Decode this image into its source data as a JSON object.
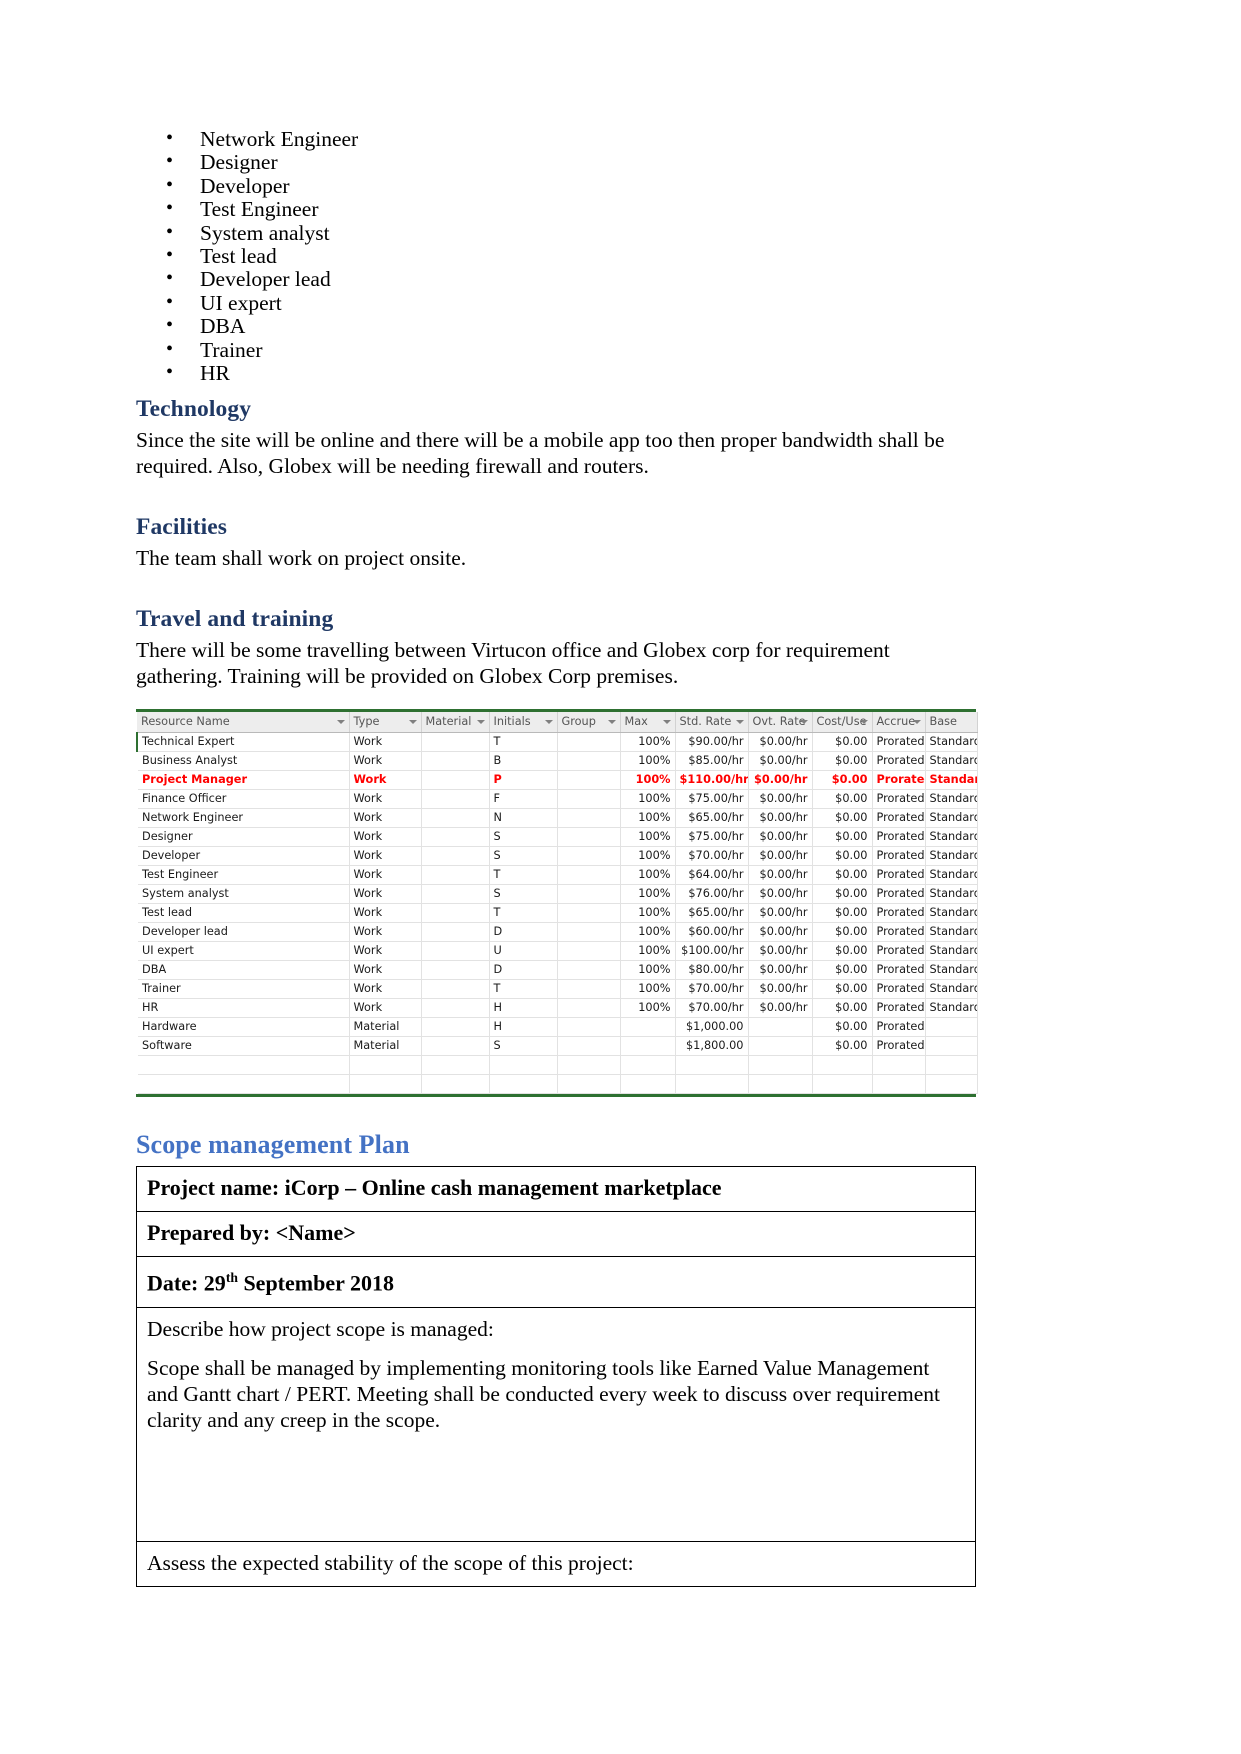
{
  "roles_list": [
    "Network Engineer",
    "Designer",
    "Developer",
    "Test Engineer",
    "System analyst",
    "Test lead",
    "Developer lead",
    "UI expert",
    "DBA",
    "Trainer",
    "HR"
  ],
  "sections": [
    {
      "heading": "Technology",
      "body": "Since the site will be online and there will be a mobile app too then proper bandwidth shall be required. Also, Globex will be needing firewall and routers."
    },
    {
      "heading": "Facilities",
      "body": "The team shall work on project onsite."
    },
    {
      "heading": "Travel and training",
      "body": "There will be some travelling between Virtucon office and Globex corp for requirement gathering. Training will be provided on Globex Corp premises."
    }
  ],
  "resource_table": {
    "columns": [
      "Resource Name",
      "Type",
      "Material",
      "Initials",
      "Group",
      "Max",
      "Std. Rate",
      "Ovt. Rate",
      "Cost/Use",
      "Accrue",
      "Base"
    ],
    "rows": [
      {
        "name": "Technical Expert",
        "type": "Work",
        "material": "",
        "initials": "T",
        "group": "",
        "max": "100%",
        "std_rate": "$90.00/hr",
        "ovt_rate": "$0.00/hr",
        "cost_use": "$0.00",
        "accrue": "Prorated",
        "base": "Standard",
        "highlight": false
      },
      {
        "name": "Business Analyst",
        "type": "Work",
        "material": "",
        "initials": "B",
        "group": "",
        "max": "100%",
        "std_rate": "$85.00/hr",
        "ovt_rate": "$0.00/hr",
        "cost_use": "$0.00",
        "accrue": "Prorated",
        "base": "Standard",
        "highlight": false
      },
      {
        "name": "Project Manager",
        "type": "Work",
        "material": "",
        "initials": "P",
        "group": "",
        "max": "100%",
        "std_rate": "$110.00/hr",
        "ovt_rate": "$0.00/hr",
        "cost_use": "$0.00",
        "accrue": "Prorated",
        "base": "Standard",
        "highlight": true
      },
      {
        "name": "Finance Officer",
        "type": "Work",
        "material": "",
        "initials": "F",
        "group": "",
        "max": "100%",
        "std_rate": "$75.00/hr",
        "ovt_rate": "$0.00/hr",
        "cost_use": "$0.00",
        "accrue": "Prorated",
        "base": "Standard",
        "highlight": false
      },
      {
        "name": "Network Engineer",
        "type": "Work",
        "material": "",
        "initials": "N",
        "group": "",
        "max": "100%",
        "std_rate": "$65.00/hr",
        "ovt_rate": "$0.00/hr",
        "cost_use": "$0.00",
        "accrue": "Prorated",
        "base": "Standard",
        "highlight": false
      },
      {
        "name": "Designer",
        "type": "Work",
        "material": "",
        "initials": "S",
        "group": "",
        "max": "100%",
        "std_rate": "$75.00/hr",
        "ovt_rate": "$0.00/hr",
        "cost_use": "$0.00",
        "accrue": "Prorated",
        "base": "Standard",
        "highlight": false
      },
      {
        "name": "Developer",
        "type": "Work",
        "material": "",
        "initials": "S",
        "group": "",
        "max": "100%",
        "std_rate": "$70.00/hr",
        "ovt_rate": "$0.00/hr",
        "cost_use": "$0.00",
        "accrue": "Prorated",
        "base": "Standard",
        "highlight": false
      },
      {
        "name": "Test Engineer",
        "type": "Work",
        "material": "",
        "initials": "T",
        "group": "",
        "max": "100%",
        "std_rate": "$64.00/hr",
        "ovt_rate": "$0.00/hr",
        "cost_use": "$0.00",
        "accrue": "Prorated",
        "base": "Standard",
        "highlight": false
      },
      {
        "name": "System analyst",
        "type": "Work",
        "material": "",
        "initials": "S",
        "group": "",
        "max": "100%",
        "std_rate": "$76.00/hr",
        "ovt_rate": "$0.00/hr",
        "cost_use": "$0.00",
        "accrue": "Prorated",
        "base": "Standard",
        "highlight": false
      },
      {
        "name": "Test lead",
        "type": "Work",
        "material": "",
        "initials": "T",
        "group": "",
        "max": "100%",
        "std_rate": "$65.00/hr",
        "ovt_rate": "$0.00/hr",
        "cost_use": "$0.00",
        "accrue": "Prorated",
        "base": "Standard",
        "highlight": false
      },
      {
        "name": "Developer lead",
        "type": "Work",
        "material": "",
        "initials": "D",
        "group": "",
        "max": "100%",
        "std_rate": "$60.00/hr",
        "ovt_rate": "$0.00/hr",
        "cost_use": "$0.00",
        "accrue": "Prorated",
        "base": "Standard",
        "highlight": false
      },
      {
        "name": "UI expert",
        "type": "Work",
        "material": "",
        "initials": "U",
        "group": "",
        "max": "100%",
        "std_rate": "$100.00/hr",
        "ovt_rate": "$0.00/hr",
        "cost_use": "$0.00",
        "accrue": "Prorated",
        "base": "Standard",
        "highlight": false
      },
      {
        "name": "DBA",
        "type": "Work",
        "material": "",
        "initials": "D",
        "group": "",
        "max": "100%",
        "std_rate": "$80.00/hr",
        "ovt_rate": "$0.00/hr",
        "cost_use": "$0.00",
        "accrue": "Prorated",
        "base": "Standard",
        "highlight": false
      },
      {
        "name": "Trainer",
        "type": "Work",
        "material": "",
        "initials": "T",
        "group": "",
        "max": "100%",
        "std_rate": "$70.00/hr",
        "ovt_rate": "$0.00/hr",
        "cost_use": "$0.00",
        "accrue": "Prorated",
        "base": "Standard",
        "highlight": false
      },
      {
        "name": "HR",
        "type": "Work",
        "material": "",
        "initials": "H",
        "group": "",
        "max": "100%",
        "std_rate": "$70.00/hr",
        "ovt_rate": "$0.00/hr",
        "cost_use": "$0.00",
        "accrue": "Prorated",
        "base": "Standard",
        "highlight": false
      },
      {
        "name": "Hardware",
        "type": "Material",
        "material": "",
        "initials": "H",
        "group": "",
        "max": "",
        "std_rate": "$1,000.00",
        "ovt_rate": "",
        "cost_use": "$0.00",
        "accrue": "Prorated",
        "base": "",
        "highlight": false
      },
      {
        "name": "Software",
        "type": "Material",
        "material": "",
        "initials": "S",
        "group": "",
        "max": "",
        "std_rate": "$1,800.00",
        "ovt_rate": "",
        "cost_use": "$0.00",
        "accrue": "Prorated",
        "base": "",
        "highlight": false
      }
    ]
  },
  "scope_section": {
    "heading": "Scope management Plan",
    "project_name": "Project name: iCorp – Online cash management marketplace",
    "prepared_by": "Prepared by: <Name>",
    "date_prefix": "Date: 29",
    "date_sup": "th",
    "date_suffix": " September 2018",
    "describe_label": "Describe how project scope is managed:",
    "describe_body": "Scope shall be managed by implementing monitoring tools like Earned Value Management and Gantt chart / PERT. Meeting shall be conducted every week to discuss over requirement clarity and any creep in the scope.",
    "assess_label": "Assess the expected stability of the scope of this project:"
  },
  "colors": {
    "heading_dark_blue": "#1F3864",
    "heading_light_blue": "#4472C4",
    "table_accent_green": "#2E7031",
    "highlight_red": "#FF0000"
  }
}
